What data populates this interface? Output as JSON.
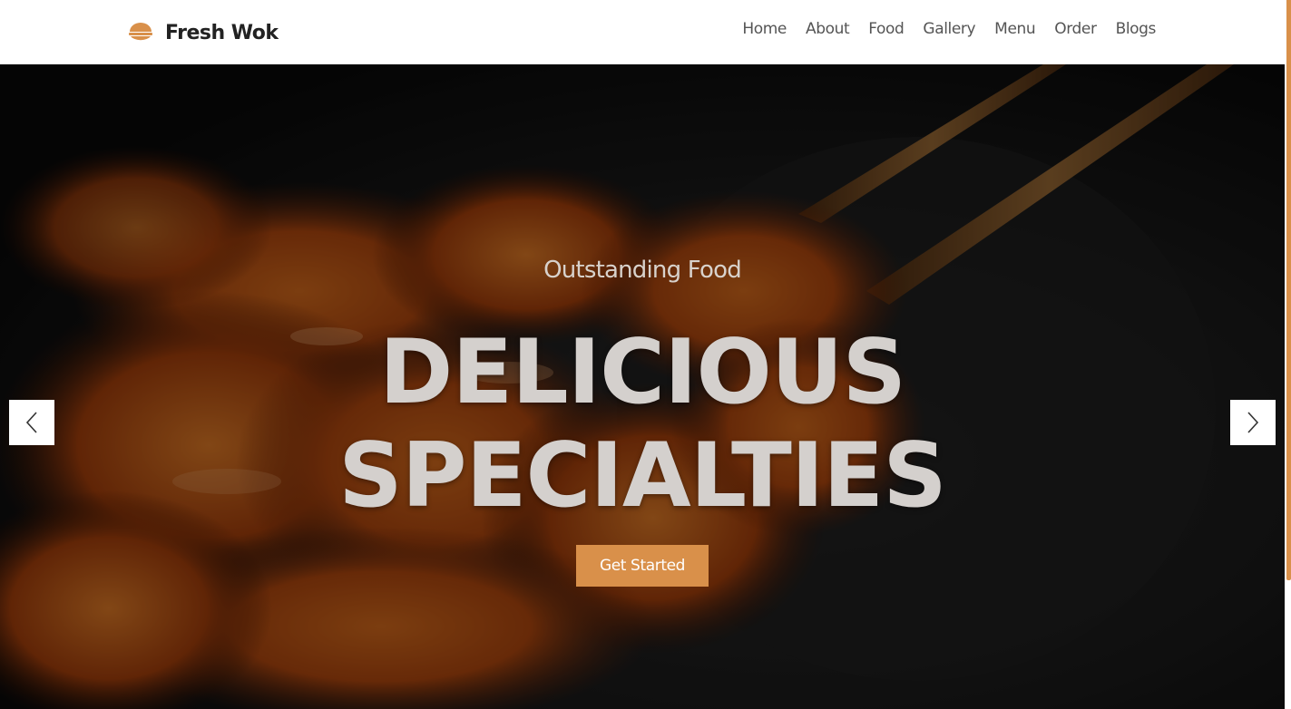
{
  "brand": {
    "name": "Fresh Wok",
    "icon": "bowl-icon",
    "accent_color": "#d9904a"
  },
  "nav": {
    "items": [
      "Home",
      "About",
      "Food",
      "Gallery",
      "Menu",
      "Order",
      "Blogs"
    ]
  },
  "hero": {
    "subtitle": "Outstanding Food",
    "title_line1": "DELICIOUS",
    "title_line2": "SPECIALTIES",
    "cta_label": "Get Started",
    "prev_icon": "chevron-left-icon",
    "next_icon": "chevron-right-icon"
  }
}
